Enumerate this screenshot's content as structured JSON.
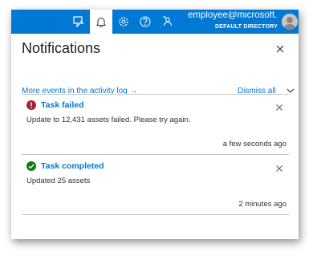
{
  "topbar": {
    "email": "employee@microsoft.c...",
    "directory": "DEFAULT DIRECTORY",
    "icons": [
      "feedback-portal-icon",
      "bell-icon",
      "gear-icon",
      "help-icon",
      "feedback-icon"
    ]
  },
  "panel": {
    "title": "Notifications",
    "activity_link": "More events in the activity log →",
    "dismiss_label": "Dismiss all"
  },
  "notifications": [
    {
      "status": "error",
      "title": "Task failed",
      "message": "Update to 12,431 assets failed. Please try again.",
      "time": "a few seconds ago"
    },
    {
      "status": "success",
      "title": "Task completed",
      "message": "Updated 25 assets",
      "time": "2 minutes ago"
    }
  ],
  "colors": {
    "accent": "#0078d4",
    "error": "#a4262c",
    "success": "#107c10"
  }
}
